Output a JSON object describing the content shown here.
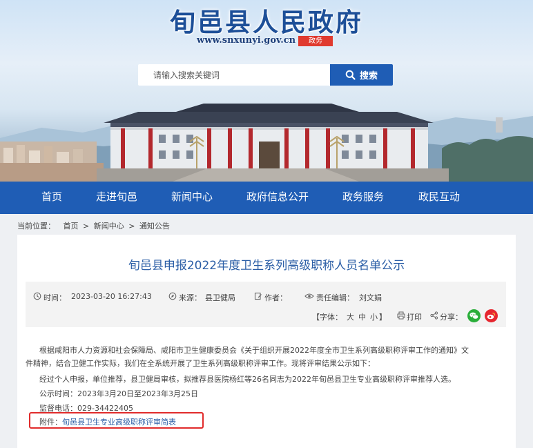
{
  "header": {
    "title": "旬邑县人民政府",
    "url": "www.snxunyi.gov.cn",
    "badge": "政务"
  },
  "search": {
    "placeholder": "请输入搜索关键词",
    "button_label": "搜索"
  },
  "nav": {
    "items": [
      "首页",
      "走进旬邑",
      "新闻中心",
      "政府信息公开",
      "政务服务",
      "政民互动"
    ]
  },
  "breadcrumb": {
    "prefix": "当前位置：",
    "items": [
      "首页",
      "新闻中心",
      "通知公告"
    ],
    "sep": ">"
  },
  "article": {
    "title": "旬邑县申报2022年度卫生系列高级职称人员名单公示",
    "meta": {
      "time_label": "时间：",
      "time": "2023-03-20 16:27:43",
      "source_label": "来源：",
      "source": "县卫健局",
      "author_label": "作者：",
      "author": "",
      "editor_label": "责任编辑：",
      "editor": "刘文娟",
      "font_label": "【字体：",
      "font_sizes": [
        "大",
        "中",
        "小"
      ],
      "font_close": "】",
      "print_label": "打印",
      "share_label": "分享："
    },
    "paragraphs": [
      "根据咸阳市人力资源和社会保障局、咸阳市卫生健康委员会《关于组织开展2022年度全市卫生系列高级职称评审工作的通知》文",
      "件精神，结合卫健工作实际，我们在全系统开展了卫生系列高级职称评审工作。现将评审结果公示如下：",
      "经过个人申报，单位推荐，县卫健局审核，拟推荐县医院杨红等26名同志为2022年旬邑县卫生专业高级职称评审推荐人选。",
      "公示时间：2023年3月20日至2023年3月25日",
      "监督电话：029-34422405"
    ],
    "attachment_label": "附件：",
    "attachment_name": "旬邑县卫生专业高级职称评审简表"
  },
  "colors": {
    "brand_blue": "#1f5db5",
    "title_blue": "#2b5ea6",
    "badge_red": "#e03a2f",
    "highlight_red": "#e12b2b",
    "wechat_green": "#2aae3a",
    "weibo_red": "#e6262f"
  },
  "icons": [
    "search-icon",
    "clock-icon",
    "compass-icon",
    "edit-icon",
    "eye-icon",
    "printer-icon",
    "share-icon",
    "wechat-icon",
    "weibo-icon"
  ]
}
